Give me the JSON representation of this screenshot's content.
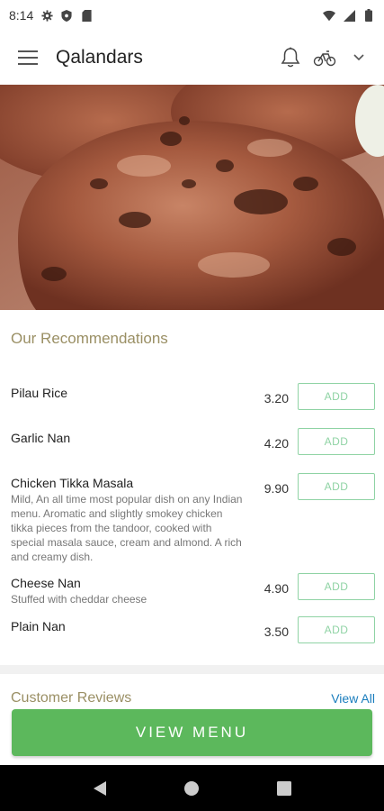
{
  "status_bar": {
    "time": "8:14",
    "left_icons": [
      "gear-icon",
      "shield-icon",
      "sd-card-icon"
    ],
    "right_icons": [
      "wifi-icon",
      "signal-icon",
      "battery-icon"
    ]
  },
  "app_bar": {
    "title": "Qalandars",
    "actions": [
      "bell-icon",
      "bike-icon",
      "chevron-down-icon"
    ]
  },
  "recommendations": {
    "title": "Our Recommendations",
    "add_label": "ADD",
    "items": [
      {
        "name": "Pilau Rice",
        "description": "",
        "price": "3.20"
      },
      {
        "name": "Garlic Nan",
        "description": "",
        "price": "4.20"
      },
      {
        "name": "Chicken Tikka Masala",
        "description": "Mild, An all time most popular dish on any Indian menu. Aromatic and slightly smokey chicken tikka pieces from the tandoor, cooked with special masala sauce, cream and almond. A rich and creamy dish.",
        "price": "9.90"
      },
      {
        "name": "Cheese Nan",
        "description": "Stuffed with cheddar cheese",
        "price": "4.90"
      },
      {
        "name": "Plain Nan",
        "description": "",
        "price": "3.50"
      }
    ]
  },
  "reviews": {
    "title": "Customer Reviews",
    "view_all": "View All"
  },
  "cta": {
    "view_menu": "VIEW MENU"
  },
  "colors": {
    "accent_green": "#5cb85c",
    "add_border": "#8fd3a4",
    "section_title": "#9a8f64",
    "link_blue": "#1a7dbd"
  }
}
